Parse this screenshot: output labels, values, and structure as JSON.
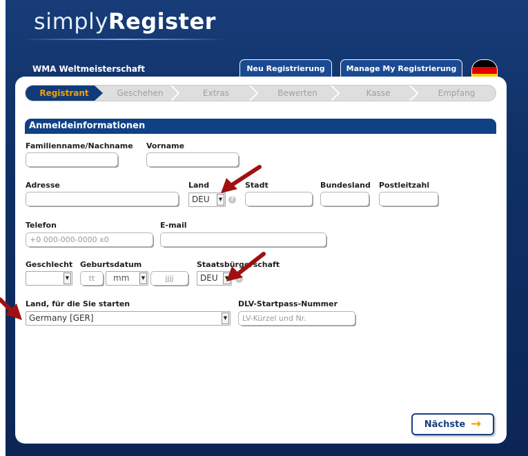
{
  "brand": {
    "light": "simply",
    "bold": "Register"
  },
  "event_title": "WMA Weltmeisterschaft",
  "top_tabs": {
    "new": "Neu Registrierung",
    "manage": "Manage My Registrierung"
  },
  "steps": [
    "Registrant",
    "Geschehen",
    "Extras",
    "Bewerten",
    "Kasse",
    "Empfang"
  ],
  "section_title": "Anmeldeinformationen",
  "form": {
    "last_name_label": "Familienname/Nachname",
    "first_name_label": "Vorname",
    "address_label": "Adresse",
    "country_label": "Land",
    "country_value": "DEU",
    "city_label": "Stadt",
    "state_label": "Bundesland",
    "zip_label": "Postleitzahl",
    "phone_label": "Telefon",
    "phone_placeholder": "+0 000-000-0000 x0",
    "email_label": "E-mail",
    "gender_label": "Geschlecht",
    "birthdate_label": "Geburtsdatum",
    "day_placeholder": "tt",
    "month_value": "mm",
    "year_placeholder": "jjjj",
    "citizenship_label": "Staatsbürgerschaft",
    "citizenship_value": "DEU",
    "compete_country_label": "Land, für die Sie starten",
    "compete_country_value": "Germany [GER]",
    "dlv_label": "DLV-Startpass-Nummer",
    "dlv_placeholder": "LV-Kürzel und Nr."
  },
  "next_button": "Nächste",
  "colors": {
    "navy": "#0f4185",
    "accent_orange": "#f2a200",
    "annotation_red": "#a01010"
  }
}
